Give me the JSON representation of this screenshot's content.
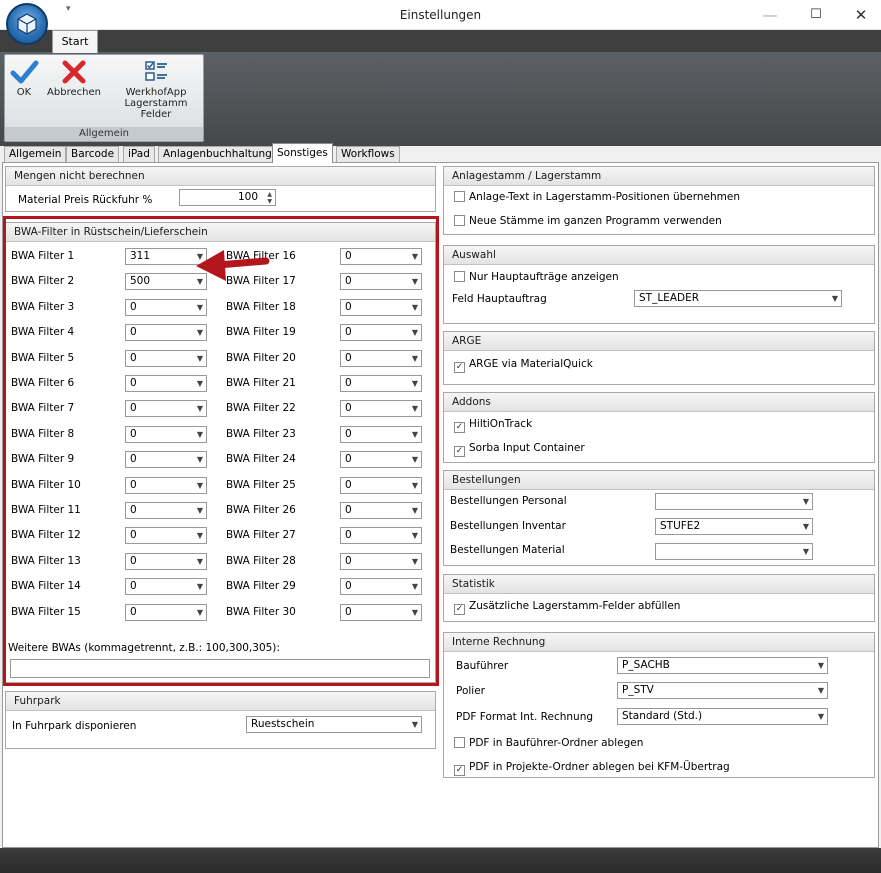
{
  "window": {
    "title": "Einstellungen",
    "minimize": "—",
    "maximize": "☐",
    "close": "✕"
  },
  "qat_arrow": "▾",
  "ribbon": {
    "tab": "Start",
    "group_label": "Allgemein",
    "buttons": [
      {
        "label": "OK",
        "icon": "checkmark-icon"
      },
      {
        "label": "Abbrechen",
        "icon": "cancel-x-icon"
      },
      {
        "label": "WerkhofApp Lagerstamm Felder",
        "icon": "checklist-icon"
      }
    ]
  },
  "tabs": [
    {
      "label": "Allgemein"
    },
    {
      "label": "Barcode"
    },
    {
      "label": "iPad"
    },
    {
      "label": "Anlagenbuchhaltung"
    },
    {
      "label": "Sonstiges"
    },
    {
      "label": "Workflows"
    }
  ],
  "mengen": {
    "title": "Mengen nicht berechnen",
    "label": "Material Preis Rückfuhr %",
    "value": "100",
    "spin": "▲▼"
  },
  "bwa": {
    "title": "BWA-Filter in Rüstschein/Lieferschein",
    "left": [
      {
        "label": "BWA Filter 1",
        "value": "311"
      },
      {
        "label": "BWA Filter 2",
        "value": "500"
      },
      {
        "label": "BWA Filter 3",
        "value": "0"
      },
      {
        "label": "BWA Filter 4",
        "value": "0"
      },
      {
        "label": "BWA Filter 5",
        "value": "0"
      },
      {
        "label": "BWA Filter 6",
        "value": "0"
      },
      {
        "label": "BWA Filter 7",
        "value": "0"
      },
      {
        "label": "BWA Filter 8",
        "value": "0"
      },
      {
        "label": "BWA Filter 9",
        "value": "0"
      },
      {
        "label": "BWA Filter 10",
        "value": "0"
      },
      {
        "label": "BWA Filter 11",
        "value": "0"
      },
      {
        "label": "BWA Filter 12",
        "value": "0"
      },
      {
        "label": "BWA Filter 13",
        "value": "0"
      },
      {
        "label": "BWA Filter 14",
        "value": "0"
      },
      {
        "label": "BWA Filter 15",
        "value": "0"
      }
    ],
    "right": [
      {
        "label": "BWA Filter 16",
        "value": "0"
      },
      {
        "label": "BWA Filter 17",
        "value": "0"
      },
      {
        "label": "BWA Filter 18",
        "value": "0"
      },
      {
        "label": "BWA Filter 19",
        "value": "0"
      },
      {
        "label": "BWA Filter 20",
        "value": "0"
      },
      {
        "label": "BWA Filter 21",
        "value": "0"
      },
      {
        "label": "BWA Filter 22",
        "value": "0"
      },
      {
        "label": "BWA Filter 23",
        "value": "0"
      },
      {
        "label": "BWA Filter 24",
        "value": "0"
      },
      {
        "label": "BWA Filter 25",
        "value": "0"
      },
      {
        "label": "BWA Filter 26",
        "value": "0"
      },
      {
        "label": "BWA Filter 27",
        "value": "0"
      },
      {
        "label": "BWA Filter 28",
        "value": "0"
      },
      {
        "label": "BWA Filter 29",
        "value": "0"
      },
      {
        "label": "BWA Filter 30",
        "value": "0"
      }
    ],
    "weitere_label": "Weitere BWAs (kommagetrennt, z.B.: 100,300,305):",
    "weitere_value": ""
  },
  "fuhrpark": {
    "title": "Fuhrpark",
    "label": "In Fuhrpark disponieren",
    "value": "Ruestschein"
  },
  "anlagestamm": {
    "title": "Anlagestamm / Lagerstamm",
    "items": [
      {
        "label": "Anlage-Text in Lagerstamm-Positionen übernehmen",
        "checked": false
      },
      {
        "label": "Neue Stämme im ganzen Programm verwenden",
        "checked": false
      }
    ]
  },
  "auswahl": {
    "title": "Auswahl",
    "checkbox": {
      "label": "Nur Hauptaufträge anzeigen",
      "checked": false
    },
    "field_label": "Feld Hauptauftrag",
    "field_value": "ST_LEADER"
  },
  "arge": {
    "title": "ARGE",
    "checkbox": {
      "label": "ARGE via MaterialQuick",
      "checked": true
    }
  },
  "addons": {
    "title": "Addons",
    "items": [
      {
        "label": "HiltiOnTrack",
        "checked": true
      },
      {
        "label": "Sorba Input Container",
        "checked": true
      }
    ]
  },
  "bestellungen": {
    "title": "Bestellungen",
    "rows": [
      {
        "label": "Bestellungen Personal",
        "value": ""
      },
      {
        "label": "Bestellungen Inventar",
        "value": "STUFE2"
      },
      {
        "label": "Bestellungen Material",
        "value": ""
      }
    ]
  },
  "statistik": {
    "title": "Statistik",
    "checkbox": {
      "label": "Zusätzliche Lagerstamm-Felder abfüllen",
      "checked": true
    }
  },
  "interne": {
    "title": "Interne Rechnung",
    "rows": [
      {
        "label": "Bauführer",
        "value": "P_SACHB"
      },
      {
        "label": "Polier",
        "value": "P_STV"
      },
      {
        "label": "PDF Format Int. Rechnung",
        "value": "Standard (Std.)"
      }
    ],
    "checkboxes": [
      {
        "label": "PDF in Bauführer-Ordner ablegen",
        "checked": false
      },
      {
        "label": "PDF in Projekte-Ordner ablegen bei KFM-Übertrag",
        "checked": true
      }
    ]
  },
  "colors": {
    "highlight": "#b3161c",
    "ok": "#2f7fd1",
    "cancel": "#d62a2a"
  }
}
